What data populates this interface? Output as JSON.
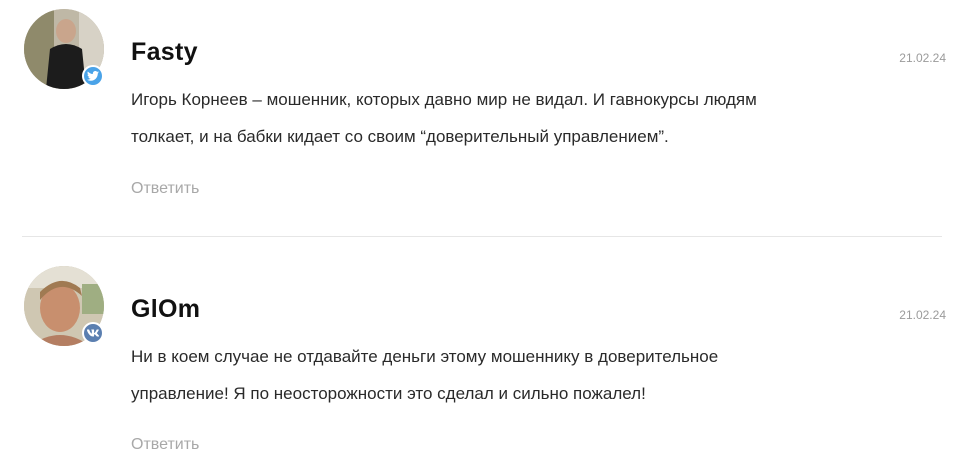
{
  "comments": [
    {
      "author": "Fasty",
      "date": "21.02.24",
      "social_badge": "twitter-icon",
      "text_lines": [
        "Игорь Корнеев – мошенник, которых давно мир не видал. И гавнокурсы людям",
        "толкает, и на бабки кидает со своим “доверительный управлением”."
      ],
      "reply_label": "Ответить"
    },
    {
      "author": "GlOm",
      "date": "21.02.24",
      "social_badge": "vk-icon",
      "text_lines": [
        "Ни в коем случае не отдавайте деньги этому мошеннику в доверительное",
        "управление! Я по неосторожности это сделал и сильно пожалел!"
      ],
      "reply_label": "Ответить"
    }
  ],
  "colors": {
    "twitter_badge": "#4aa3e8",
    "vk_badge": "#5b7fb0",
    "reply_text": "#a8a8a8",
    "date_text": "#9b9b9b"
  }
}
